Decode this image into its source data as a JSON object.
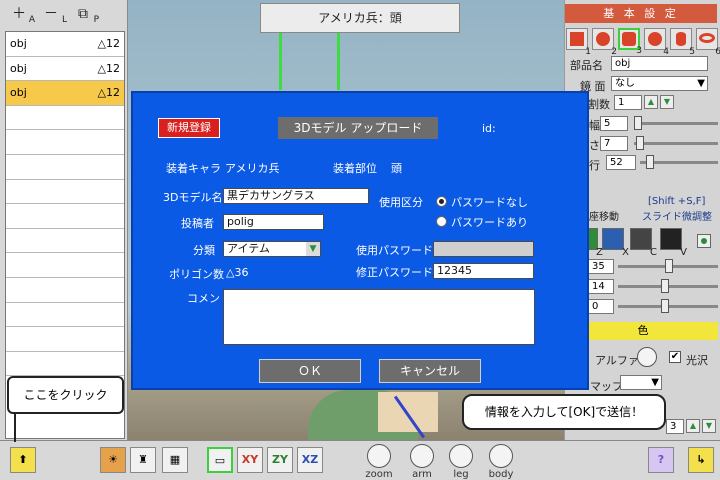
{
  "left_panel": {
    "toolbar": [
      {
        "icon": "add-icon",
        "glyph": "+",
        "sub": "A"
      },
      {
        "icon": "remove-icon",
        "glyph": "−",
        "sub": "L"
      },
      {
        "icon": "copy-icon",
        "glyph": "⧉",
        "sub": "P"
      }
    ],
    "objects": [
      {
        "name": "obj",
        "polys": "△12",
        "selected": false
      },
      {
        "name": "obj",
        "polys": "△12",
        "selected": false
      },
      {
        "name": "obj",
        "polys": "△12",
        "selected": true
      }
    ]
  },
  "viewport": {
    "title": "アメリカ兵：頭"
  },
  "right_panel": {
    "header": "基 本 設 定",
    "shape_buttons": [
      "1",
      "2",
      "3",
      "4",
      "5",
      "6"
    ],
    "part_name_label": "部品名",
    "part_name_value": "obj",
    "mirror_label": "鏡 面",
    "mirror_value": "なし",
    "division_label": "割数",
    "division_value": "1",
    "width_label": "幅",
    "width_value": "5",
    "depth_label": "さ",
    "depth_value": "7",
    "height_label": "行",
    "height_value": "52",
    "move_label": "座移動",
    "shift_note": "[Shift +S,F]",
    "fine_adjust_label": "スライド微調整",
    "tool_keys": [
      "Z",
      "X",
      "C",
      "V"
    ],
    "value_a": "35",
    "value_b": "14",
    "value_c": "0",
    "color_label": "色",
    "alpha_label": "アルファ",
    "gloss_label": "光沢",
    "map_label": "マップ",
    "last_value": "3"
  },
  "dialog": {
    "new_register_label": "新規登録",
    "title": "3Dモデル アップロード",
    "id_label": "id:",
    "wearer_label": "装着キャラ",
    "wearer_value": "アメリカ兵",
    "part_label": "装着部位",
    "part_value": "頭",
    "model_name_label": "3Dモデル名",
    "model_name_value": "黒デカサングラス",
    "usage_label": "使用区分",
    "radio_no_password": "パスワードなし",
    "radio_with_password": "パスワードあり",
    "poster_label": "投稿者",
    "poster_value": "polig",
    "category_label": "分類",
    "category_value": "アイテム",
    "use_password_label": "使用パスワード",
    "use_password_value": "",
    "polygon_label": "ポリゴン数",
    "polygon_value": "△36",
    "edit_password_label": "修正パスワード",
    "edit_password_value": "12345",
    "comment_label": "コメント",
    "comment_value": "",
    "ok_label": "ＯＫ",
    "cancel_label": "キャンセル"
  },
  "bottom_bar": {
    "plane_buttons": [
      "XY",
      "ZY",
      "XZ"
    ],
    "dials": [
      "zoom",
      "arm",
      "leg",
      "body"
    ],
    "help_glyph": "?"
  },
  "callouts": {
    "click_here": "ここをクリック",
    "send_info": "情報を入力して[OK]で送信！"
  }
}
